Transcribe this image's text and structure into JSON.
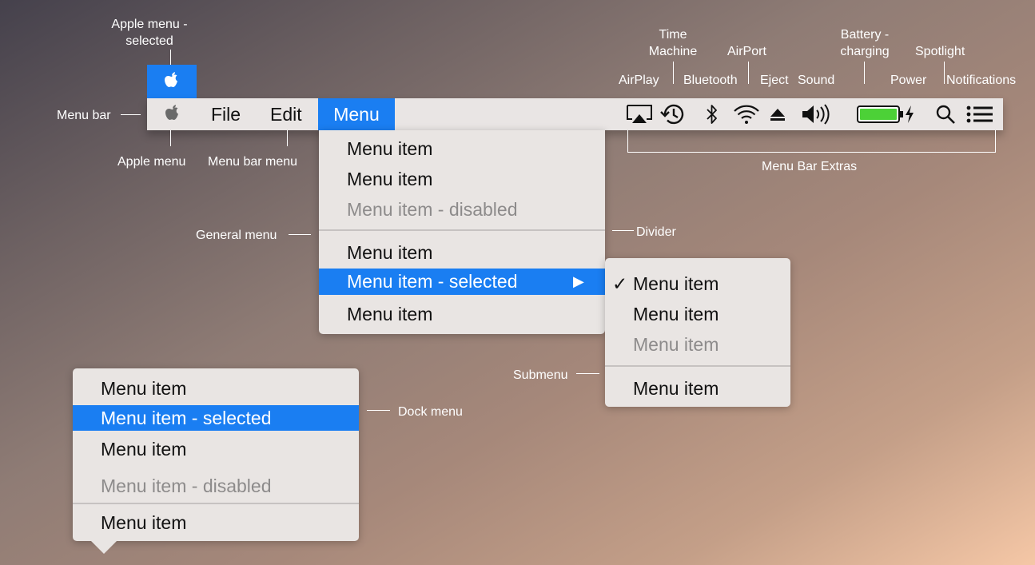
{
  "labels": {
    "apple_menu_selected": [
      "Apple menu -",
      "selected"
    ],
    "menu_bar": "Menu bar",
    "apple_menu": "Apple menu",
    "menu_bar_menu": "Menu bar menu",
    "general_menu": "General menu",
    "divider": "Divider",
    "submenu": "Submenu",
    "dock_menu": "Dock menu",
    "menu_bar_extras": "Menu Bar Extras",
    "airplay": "AirPlay",
    "time_machine": [
      "Time",
      "Machine"
    ],
    "bluetooth": "Bluetooth",
    "airport": "AirPort",
    "eject": "Eject",
    "sound": "Sound",
    "battery": [
      "Battery -",
      "charging"
    ],
    "power": "Power",
    "spotlight": "Spotlight",
    "notifications": "Notifications"
  },
  "menubar": {
    "file": "File",
    "edit": "Edit",
    "menu": "Menu",
    "extras_icons": [
      "airplay-icon",
      "time-machine-icon",
      "bluetooth-icon",
      "wifi-icon",
      "eject-icon",
      "volume-icon",
      "battery-icon",
      "power-icon",
      "search-icon",
      "notifications-icon"
    ]
  },
  "general_menu": {
    "items": [
      {
        "label": "Menu item",
        "state": "normal"
      },
      {
        "label": "Menu item",
        "state": "normal"
      },
      {
        "label": "Menu item - disabled",
        "state": "disabled"
      },
      {
        "label": "Menu item",
        "state": "normal"
      },
      {
        "label": "Menu item - selected",
        "state": "selected",
        "submenu_arrow": "▶"
      },
      {
        "label": "Menu item",
        "state": "normal"
      }
    ]
  },
  "submenu": {
    "items": [
      {
        "label": "Menu item",
        "checked": true,
        "check": "✓"
      },
      {
        "label": "Menu item"
      },
      {
        "label": "Menu item",
        "state": "disabled"
      },
      {
        "label": "Menu item"
      }
    ]
  },
  "dock_menu": {
    "items": [
      {
        "label": "Menu item"
      },
      {
        "label": "Menu item - selected",
        "state": "selected"
      },
      {
        "label": "Menu item"
      },
      {
        "label": "Menu item - disabled",
        "state": "disabled"
      },
      {
        "label": "Menu item"
      }
    ]
  },
  "colors": {
    "selection": "#1a7ef2",
    "menu_bg": "#e9e5e3",
    "battery": "#4cd137"
  }
}
